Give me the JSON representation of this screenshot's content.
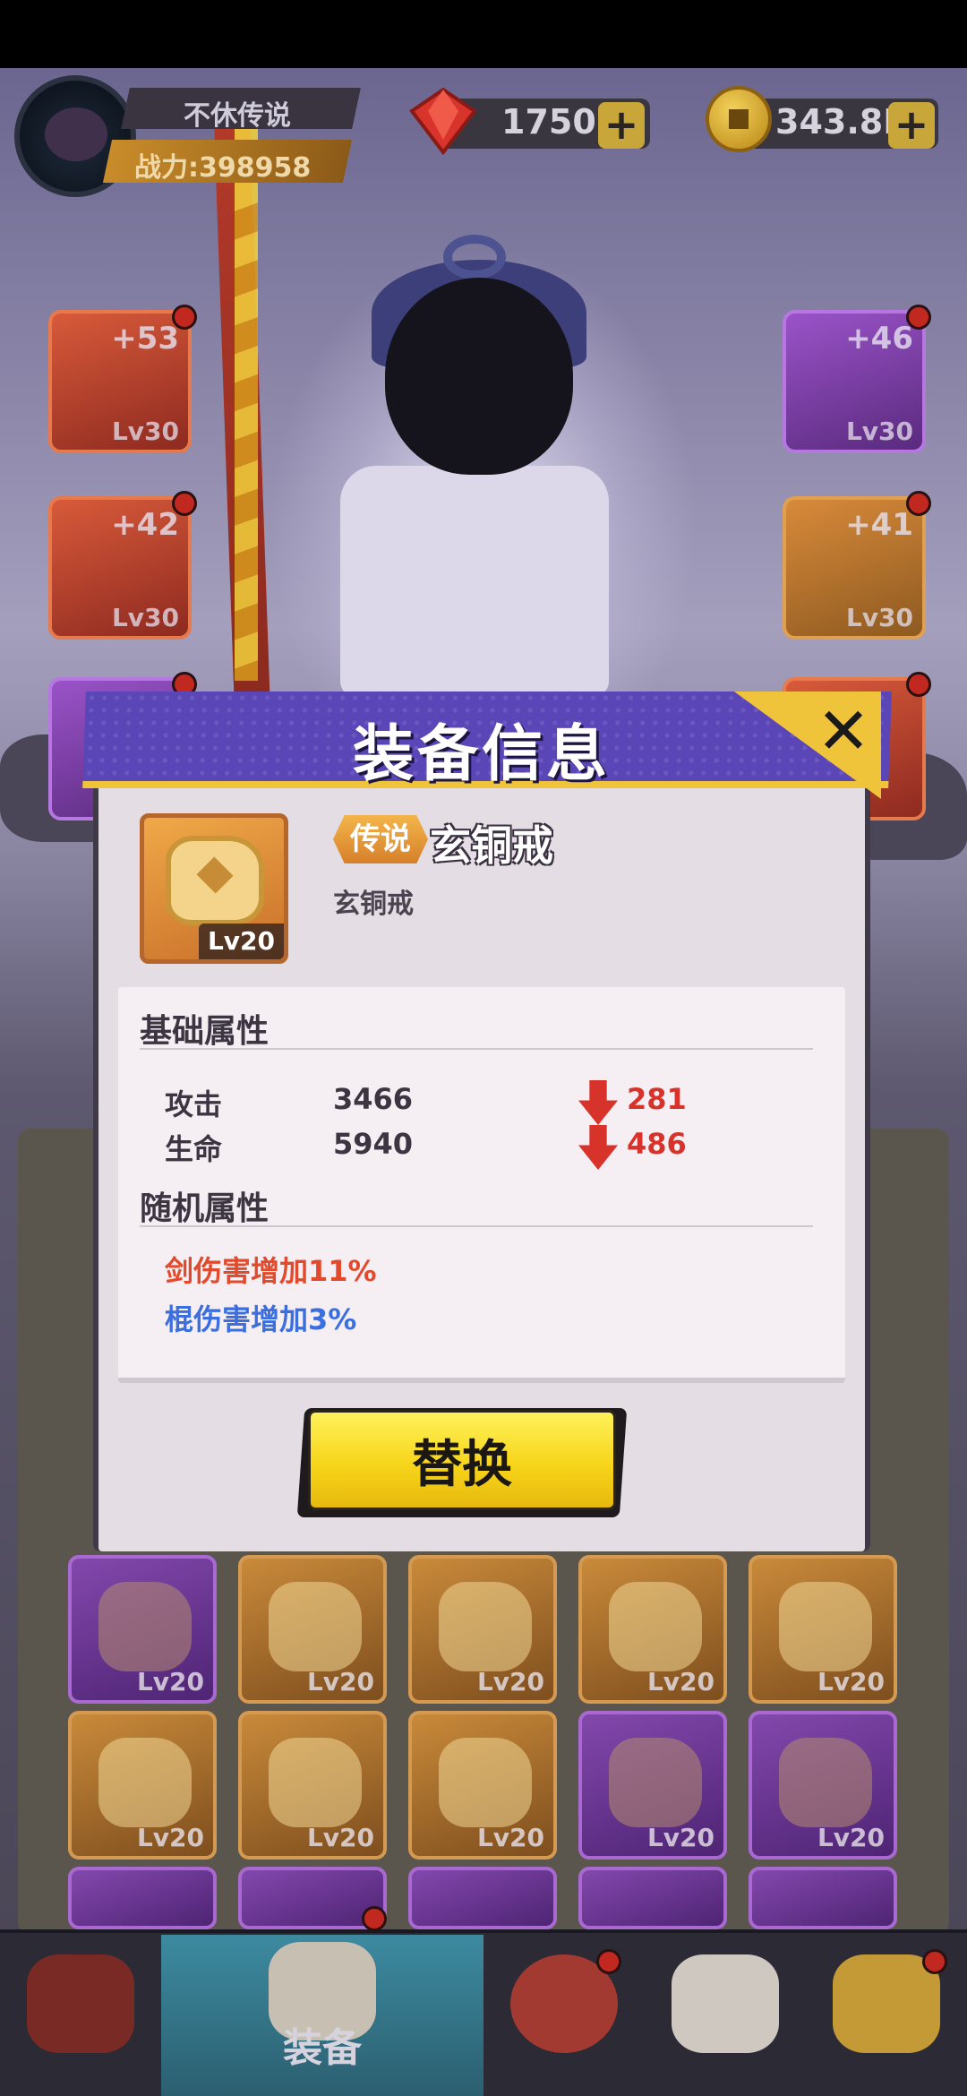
{
  "colors": {
    "modal_header": "#5b46b8",
    "accent_gold": "#f0c43a",
    "stat_decrease": "#d8332a",
    "random_attr_1": "#e24a2c",
    "random_attr_2": "#3b6fe0",
    "replace_button": "#f7d51a"
  },
  "player": {
    "name": "不休传说",
    "power": "战力:398958"
  },
  "resources": {
    "gems": "1750",
    "gold": "343.8K",
    "gems_icon": "ruby-gem-icon",
    "gold_icon": "gold-coin-icon"
  },
  "side_slots": [
    {
      "plus": "+53",
      "level": "Lv30",
      "rarity": "red"
    },
    {
      "plus": "+42",
      "level": "Lv30",
      "rarity": "red"
    },
    {
      "plus": "+46",
      "level": "Lv30",
      "rarity": "purple"
    },
    {
      "plus": "+41",
      "level": "Lv30",
      "rarity": "orange"
    }
  ],
  "modal": {
    "title": "装备信息",
    "close_icon": "close-icon",
    "item": {
      "rarity": "传说",
      "name": "玄铜戒",
      "subtitle": "玄铜戒",
      "level": "Lv20",
      "icon": "bronze-ring-icon"
    },
    "base_section": {
      "title": "基础属性",
      "stats": [
        {
          "name": "攻击",
          "value": "3466",
          "diff": "281",
          "trend": "down"
        },
        {
          "name": "生命",
          "value": "5940",
          "diff": "486",
          "trend": "down"
        }
      ]
    },
    "random_section": {
      "title": "随机属性",
      "lines": [
        {
          "text": "剑伤害增加11%",
          "color": "#e24a2c"
        },
        {
          "text": "棍伤害增加3%",
          "color": "#3b6fe0"
        }
      ]
    },
    "replace_label": "替换"
  },
  "inventory_levels": [
    "Lv20",
    "Lv20",
    "Lv20",
    "Lv20",
    "Lv20",
    "Lv20",
    "Lv20",
    "Lv20",
    "Lv20",
    "Lv20"
  ],
  "bottom_nav": {
    "active_label": "装备",
    "tabs": [
      "hero-tab-icon",
      "equipment-tab-icon",
      "drum-tab-icon",
      "scroll-tab-icon",
      "gate-tab-icon"
    ]
  }
}
